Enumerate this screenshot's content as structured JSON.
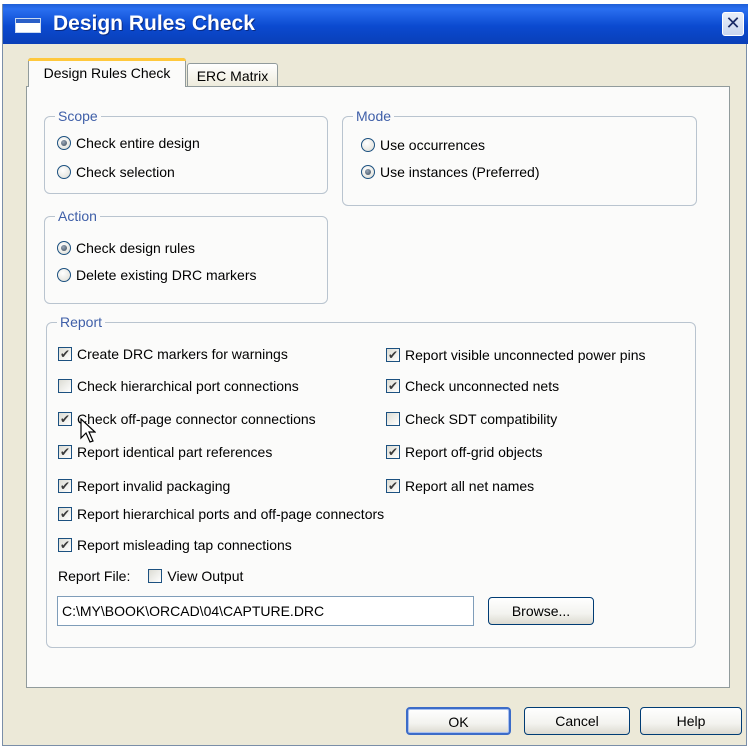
{
  "window": {
    "title": "Design Rules Check",
    "close_icon": "✕"
  },
  "tabs": [
    {
      "label": "Design Rules Check",
      "active": true
    },
    {
      "label": "ERC Matrix",
      "active": false
    }
  ],
  "scope": {
    "label": "Scope",
    "options": [
      {
        "label": "Check entire design",
        "selected": true
      },
      {
        "label": "Check selection",
        "selected": false
      }
    ]
  },
  "mode": {
    "label": "Mode",
    "options": [
      {
        "label": "Use occurrences",
        "selected": false
      },
      {
        "label": "Use instances (Preferred)",
        "selected": true
      }
    ]
  },
  "action": {
    "label": "Action",
    "options": [
      {
        "label": "Check design rules",
        "selected": true
      },
      {
        "label": "Delete existing DRC markers",
        "selected": false
      }
    ]
  },
  "report": {
    "label": "Report",
    "left_checks": [
      {
        "label": "Create DRC markers for warnings",
        "checked": true
      },
      {
        "label": "Check hierarchical port connections",
        "checked": false
      },
      {
        "label": "Check off-page connector connections",
        "checked": true
      },
      {
        "label": "Report identical part references",
        "checked": true
      },
      {
        "label": "Report invalid packaging",
        "checked": true
      },
      {
        "label": "Report hierarchical ports and off-page connectors",
        "checked": true
      },
      {
        "label": "Report misleading tap connections",
        "checked": true
      }
    ],
    "right_checks": [
      {
        "label": "Report visible unconnected power pins",
        "checked": true
      },
      {
        "label": "Check unconnected nets",
        "checked": true
      },
      {
        "label": "Check SDT compatibility",
        "checked": false
      },
      {
        "label": "Report off-grid objects",
        "checked": true
      },
      {
        "label": "Report all net names",
        "checked": true
      }
    ],
    "report_file_label": "Report File:",
    "view_output": {
      "label": "View Output",
      "checked": false
    },
    "file_path": "C:\\MY\\BOOK\\ORCAD\\04\\CAPTURE.DRC",
    "browse_label": "Browse..."
  },
  "buttons": {
    "ok": "OK",
    "cancel": "Cancel",
    "help": "Help"
  }
}
